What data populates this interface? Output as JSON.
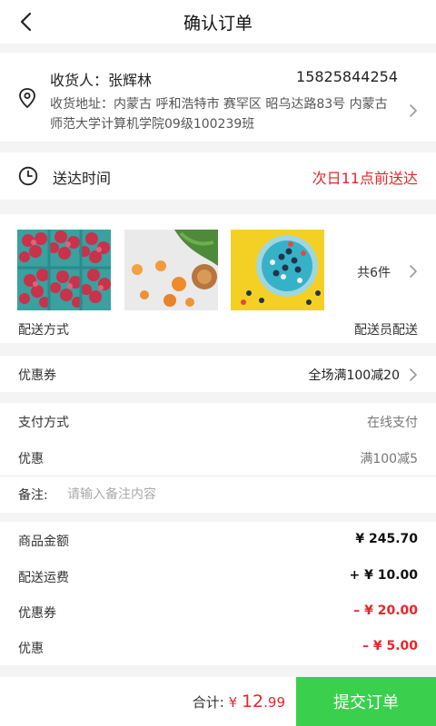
{
  "header": {
    "title": "确认订单",
    "back_icon": "back-arrow-icon"
  },
  "address": {
    "recipient": "收货人：张辉林",
    "phone": "15825844254",
    "address": "收货地址：内蒙古 呼和浩特市 赛罕区 昭乌达路83号 内蒙古师范大学计算机学院09级100239班",
    "icon": "location-pin-icon"
  },
  "delivery": {
    "label": "送达时间",
    "time": "次日11点前送达",
    "icon": "clock-icon",
    "time_color": "#e5262b"
  },
  "products": {
    "thumbnails": [
      "raspberries",
      "apricots",
      "fruit-bowl"
    ],
    "count": "共6件",
    "shipping_label": "配送方式",
    "shipping_value": "配送员配送"
  },
  "coupon": {
    "label": "优惠券",
    "value": "全场满100减20"
  },
  "payment": {
    "method_label": "支付方式",
    "method_value": "在线支付",
    "discount_label": "优惠",
    "discount_value": "满100减5",
    "note_label": "备注:",
    "note_placeholder": "请输入备注内容"
  },
  "summary": {
    "rows": [
      {
        "label": "商品金额",
        "value": "¥ 245.70"
      },
      {
        "label": "配送运费",
        "value": "+ ¥ 10.00"
      },
      {
        "label": "优惠券",
        "value": "– ¥ 20.00"
      },
      {
        "label": "优惠",
        "value": "– ¥ 5.00"
      }
    ]
  },
  "footer": {
    "total_label": "合计:",
    "currency": "¥",
    "total_int": "12",
    "total_dec": ".99",
    "submit_label": "提交订单",
    "accent": "#3ad04e"
  }
}
